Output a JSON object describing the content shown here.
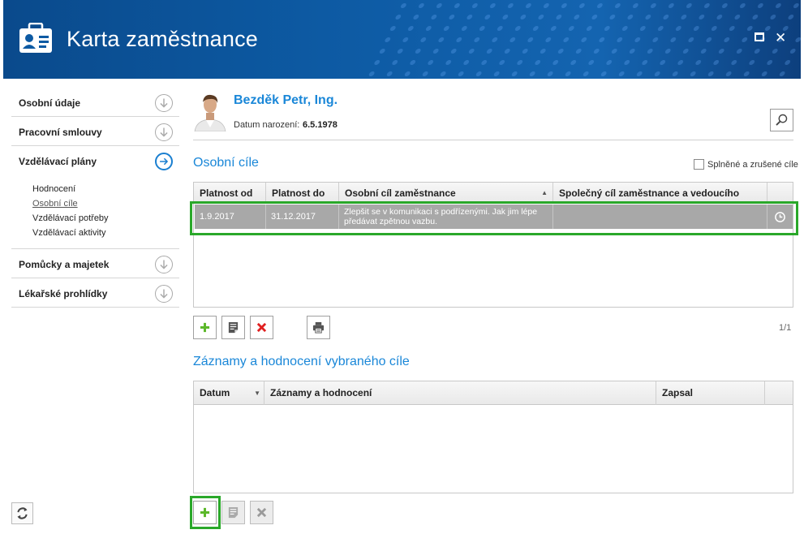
{
  "window": {
    "title": "Karta zaměstnance",
    "accent_color": "#1a87d8",
    "header_color": "#0d5aa3",
    "selection_highlight_color": "#2aa82a"
  },
  "sidebar": {
    "items": [
      {
        "label": "Osobní údaje",
        "icon": "arrow-down-circle-icon"
      },
      {
        "label": "Pracovní smlouvy",
        "icon": "arrow-down-circle-icon"
      },
      {
        "label": "Vzdělávací plány",
        "icon": "arrow-right-circle-icon",
        "active": true
      },
      {
        "label": "Pomůcky a majetek",
        "icon": "arrow-down-circle-icon"
      },
      {
        "label": "Lékařské prohlídky",
        "icon": "arrow-down-circle-icon"
      }
    ],
    "subitems": [
      "Hodnocení",
      "Osobní cíle",
      "Vzdělávací potřeby",
      "Vzdělávací aktivity"
    ],
    "selected_subitem": "Osobní cíle"
  },
  "person": {
    "name": "Bezděk Petr, Ing.",
    "dob_label": "Datum narození:",
    "dob_value": "6.5.1978"
  },
  "goals": {
    "title": "Osobní cíle",
    "filter_label": "Splněné a zrušené cíle",
    "filter_checked": false,
    "columns": [
      "Platnost od",
      "Platnost do",
      "Osobní cíl zaměstnance",
      "Společný cíl zaměstnance a vedoucího"
    ],
    "sorted_column": "Osobní cíl zaměstnance",
    "rows": [
      {
        "platnost_od": "1.9.2017",
        "platnost_do": "31.12.2017",
        "osobni_cil": "Zlepšit se v komunikaci s podřízenými. Jak jim lépe předávat zpětnou vazbu.",
        "spolecny_cil": "",
        "row_icon": "history-clock-icon"
      }
    ],
    "pager": "1/1"
  },
  "records": {
    "title": "Záznamy a hodnocení vybraného cíle",
    "columns": [
      "Datum",
      "Záznamy a hodnocení",
      "Zapsal"
    ],
    "sorted_column": "Datum",
    "rows": []
  }
}
